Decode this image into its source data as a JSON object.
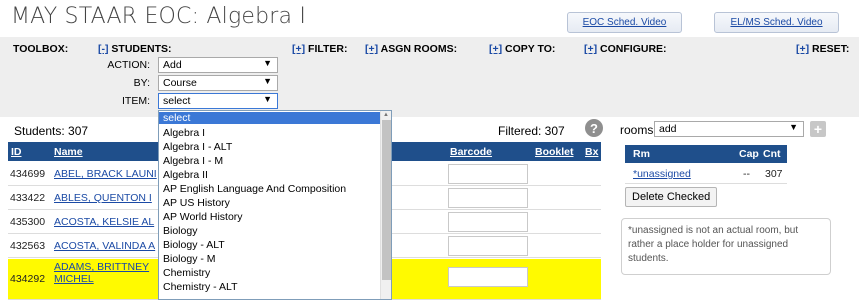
{
  "page": {
    "title": "MAY STAAR EOC: Algebra I",
    "video_buttons": [
      {
        "label": "EOC Sched. Video"
      },
      {
        "label": "EL/MS Sched. Video"
      }
    ]
  },
  "toolbox": {
    "label": "TOOLBOX:",
    "students": {
      "toggle": "[-]",
      "text": "STUDENTS:"
    },
    "filter": {
      "toggle": "[+]",
      "text": "FILTER:"
    },
    "asgn_rooms": {
      "toggle": "[+]",
      "text": "ASGN ROOMS:"
    },
    "copy_to": {
      "toggle": "[+]",
      "text": "COPY TO:"
    },
    "configure": {
      "toggle": "[+]",
      "text": "CONFIGURE:"
    },
    "reset": {
      "toggle": "[+]",
      "text": "RESET:"
    },
    "action_label": "ACTION:",
    "action_value": "Add",
    "by_label": "BY:",
    "by_value": "Course",
    "item_label": "ITEM:",
    "item_value": "select"
  },
  "dropdown": {
    "options": [
      "select",
      "Algebra I",
      "Algebra I - ALT",
      "Algebra I - M",
      "Algebra II",
      "AP English Language And Composition",
      "AP US History",
      "AP World History",
      "Biology",
      "Biology - ALT",
      "Biology - M",
      "Chemistry",
      "Chemistry - ALT"
    ],
    "selected_index": 0
  },
  "students": {
    "count_text": "Students: 307",
    "filtered_text": "Filtered: 307",
    "columns": {
      "id": "ID",
      "name": "Name",
      "barcode": "Barcode",
      "booklet": "Booklet",
      "bx": "Bx"
    },
    "rows": [
      {
        "id": "434699",
        "name": "ABEL, BRACK LAUNI",
        "highlight": false
      },
      {
        "id": "433422",
        "name": "ABLES, QUENTON I",
        "highlight": false
      },
      {
        "id": "435300",
        "name": "ACOSTA, KELSIE AL",
        "highlight": false
      },
      {
        "id": "432563",
        "name": "ACOSTA, VALINDA A",
        "highlight": false
      },
      {
        "id": "434292",
        "name": "ADAMS, BRITTNEY",
        "name2": "MICHEL",
        "highlight": true
      }
    ]
  },
  "rooms": {
    "label": "rooms:",
    "select_value": "add",
    "columns": {
      "rm": "Rm",
      "cap": "Cap",
      "cnt": "Cnt"
    },
    "rows": [
      {
        "rm": "*unassigned",
        "cap": "--",
        "cnt": "307"
      }
    ],
    "delete_label": "Delete Checked",
    "note": "*unassigned is not an actual room, but rather a place holder for unassigned students."
  },
  "colors": {
    "header_blue": "#1f4f8b",
    "link_blue": "#1b4aa5",
    "highlight_yellow": "#fffa00",
    "selected_blue": "#3b78d6"
  }
}
